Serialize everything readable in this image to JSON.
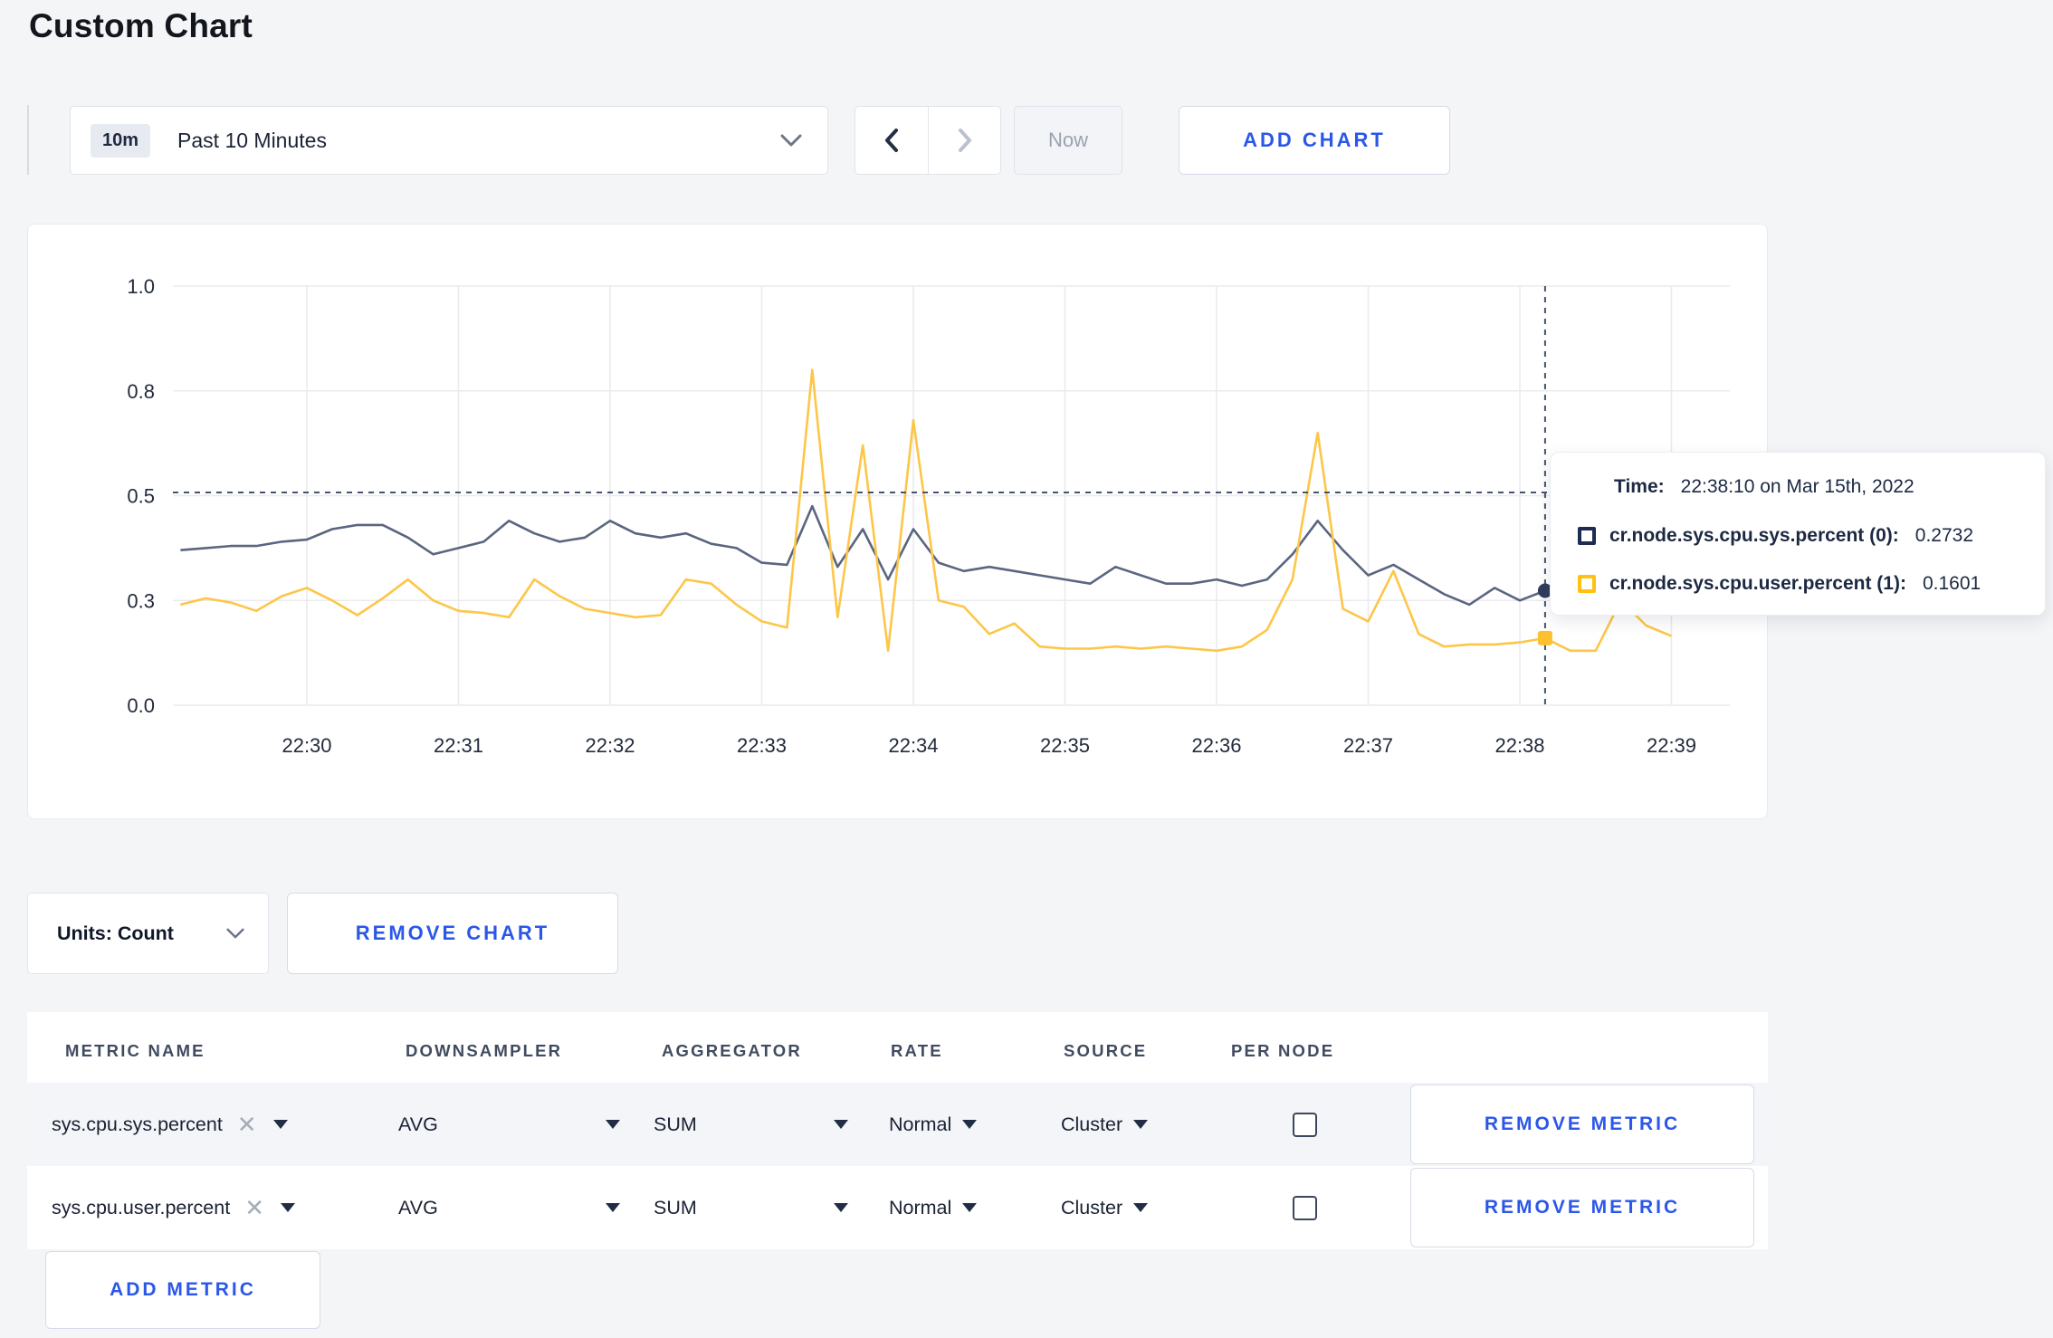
{
  "page": {
    "title": "Custom Chart",
    "background_color": "#f4f5f7",
    "accent_blue": "#2b57e8"
  },
  "toolbar": {
    "time_range": {
      "badge": "10m",
      "label": "Past 10 Minutes"
    },
    "now_label": "Now",
    "add_chart_label": "ADD CHART"
  },
  "chart_controls": {
    "units_label": "Units: Count",
    "remove_chart_label": "REMOVE CHART"
  },
  "tooltip": {
    "time_label": "Time:",
    "time_value": "22:38:10 on Mar 15th, 2022",
    "series": [
      {
        "name": "cr.node.sys.cpu.sys.percent (0):",
        "value": "0.2732",
        "swatch_color": "#1d2c50"
      },
      {
        "name": "cr.node.sys.cpu.user.percent (1):",
        "value": "0.1601",
        "swatch_color": "#ffc112"
      }
    ]
  },
  "chart_data": {
    "type": "line",
    "title": "",
    "xlabel": "",
    "ylabel": "",
    "grid": true,
    "legend_position": "none",
    "x_ticks": [
      "22:30",
      "22:31",
      "22:32",
      "22:33",
      "22:34",
      "22:35",
      "22:36",
      "22:37",
      "22:38",
      "22:39"
    ],
    "y_ticks": [
      {
        "v": 0.0,
        "label": "0.0"
      },
      {
        "v": 0.25,
        "label": "0.3"
      },
      {
        "v": 0.5,
        "label": "0.5"
      },
      {
        "v": 0.75,
        "label": "0.8"
      },
      {
        "v": 1.0,
        "label": "1.0"
      }
    ],
    "y_max": 1.0,
    "x_start": "22:29:10",
    "x_step_seconds": 10,
    "series": [
      {
        "name": "cr.node.sys.cpu.sys.percent",
        "color": "#5a6580",
        "marker": "circle",
        "marker_color": "#313d5c",
        "values": [
          0.37,
          0.375,
          0.38,
          0.38,
          0.39,
          0.395,
          0.42,
          0.43,
          0.43,
          0.4,
          0.36,
          0.375,
          0.39,
          0.44,
          0.41,
          0.39,
          0.4,
          0.44,
          0.41,
          0.4,
          0.41,
          0.385,
          0.375,
          0.34,
          0.335,
          0.475,
          0.33,
          0.42,
          0.3,
          0.42,
          0.34,
          0.32,
          0.33,
          0.32,
          0.31,
          0.3,
          0.29,
          0.33,
          0.31,
          0.29,
          0.29,
          0.3,
          0.285,
          0.3,
          0.36,
          0.44,
          0.37,
          0.31,
          0.335,
          0.3,
          0.265,
          0.24,
          0.28,
          0.25,
          0.2732,
          0.25,
          0.27,
          0.295,
          0.28,
          0.29
        ]
      },
      {
        "name": "cr.node.sys.cpu.user.percent",
        "color": "#fdc648",
        "marker": "square",
        "marker_color": "#fdc12f",
        "values": [
          0.24,
          0.255,
          0.245,
          0.225,
          0.26,
          0.28,
          0.25,
          0.215,
          0.255,
          0.3,
          0.25,
          0.225,
          0.22,
          0.21,
          0.3,
          0.26,
          0.23,
          0.22,
          0.21,
          0.215,
          0.3,
          0.29,
          0.24,
          0.2,
          0.185,
          0.8,
          0.21,
          0.62,
          0.13,
          0.68,
          0.25,
          0.235,
          0.17,
          0.195,
          0.14,
          0.135,
          0.135,
          0.14,
          0.135,
          0.14,
          0.135,
          0.13,
          0.14,
          0.18,
          0.3,
          0.65,
          0.23,
          0.2,
          0.32,
          0.17,
          0.14,
          0.145,
          0.145,
          0.15,
          0.1601,
          0.13,
          0.13,
          0.25,
          0.19,
          0.165
        ]
      }
    ],
    "crosshair": {
      "time": "22:38:10",
      "hover_value": 0.5076,
      "points": [
        {
          "series": 0,
          "value": 0.2732
        },
        {
          "series": 1,
          "value": 0.1601
        }
      ],
      "color": "#46536f"
    }
  },
  "metrics_table": {
    "headers": [
      "METRIC NAME",
      "DOWNSAMPLER",
      "AGGREGATOR",
      "RATE",
      "SOURCE",
      "PER NODE"
    ],
    "rows": [
      {
        "metric": "sys.cpu.sys.percent",
        "downsampler": "AVG",
        "aggregator": "SUM",
        "rate": "Normal",
        "source": "Cluster",
        "per_node_checked": false
      },
      {
        "metric": "sys.cpu.user.percent",
        "downsampler": "AVG",
        "aggregator": "SUM",
        "rate": "Normal",
        "source": "Cluster",
        "per_node_checked": false
      }
    ],
    "remove_metric_label": "REMOVE METRIC",
    "add_metric_label": "ADD METRIC"
  }
}
